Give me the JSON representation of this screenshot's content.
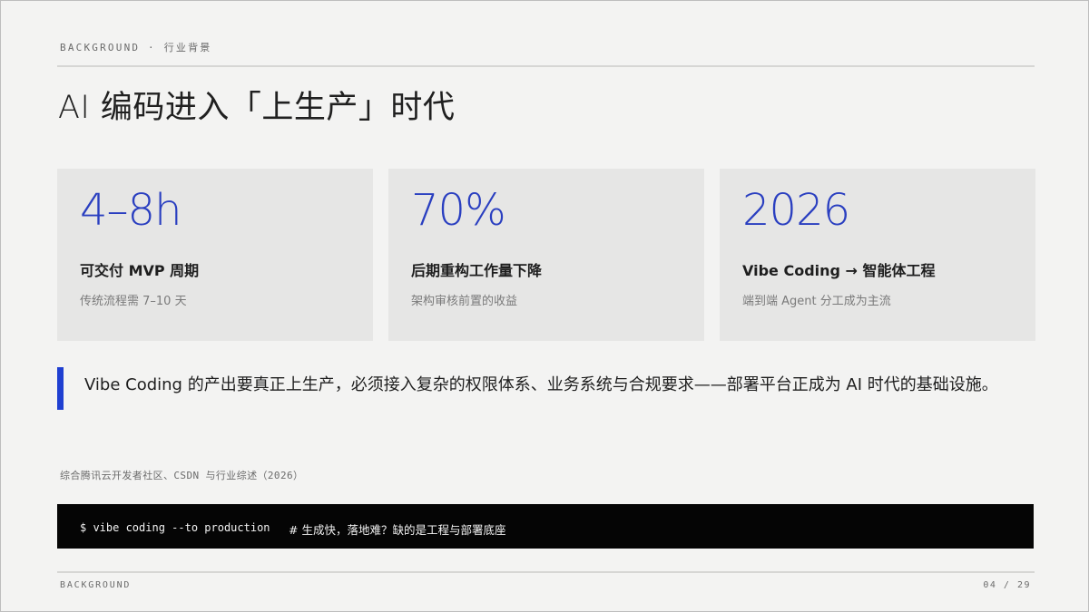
{
  "header": {
    "eyebrow": "BACKGROUND · 行业背景"
  },
  "title": "AI 编码进入「上生产」时代",
  "stats": [
    {
      "value": "4–8h",
      "label": "可交付 MVP 周期",
      "sub": "传统流程需 7–10 天"
    },
    {
      "value": "70%",
      "label": "后期重构工作量下降",
      "sub": "架构审核前置的收益"
    },
    {
      "value": "2026",
      "label": "Vibe Coding → 智能体工程",
      "sub": "端到端 Agent 分工成为主流"
    }
  ],
  "quote": "Vibe Coding 的产出要真正上生产，必须接入复杂的权限体系、业务系统与合规要求——部署平台正成为 AI 时代的基础设施。",
  "source": "综合腾讯云开发者社区、CSDN 与行业综述（2026）",
  "terminal": {
    "command": "$ vibe coding --to production",
    "comment": "# 生成快，落地难？缺的是工程与部署底座"
  },
  "footer": {
    "section": "BACKGROUND",
    "page": "04 / 29"
  },
  "colors": {
    "accent": "#2a3fc0",
    "background": "#f3f3f2",
    "card": "#e6e6e5",
    "terminal": "#050505"
  }
}
